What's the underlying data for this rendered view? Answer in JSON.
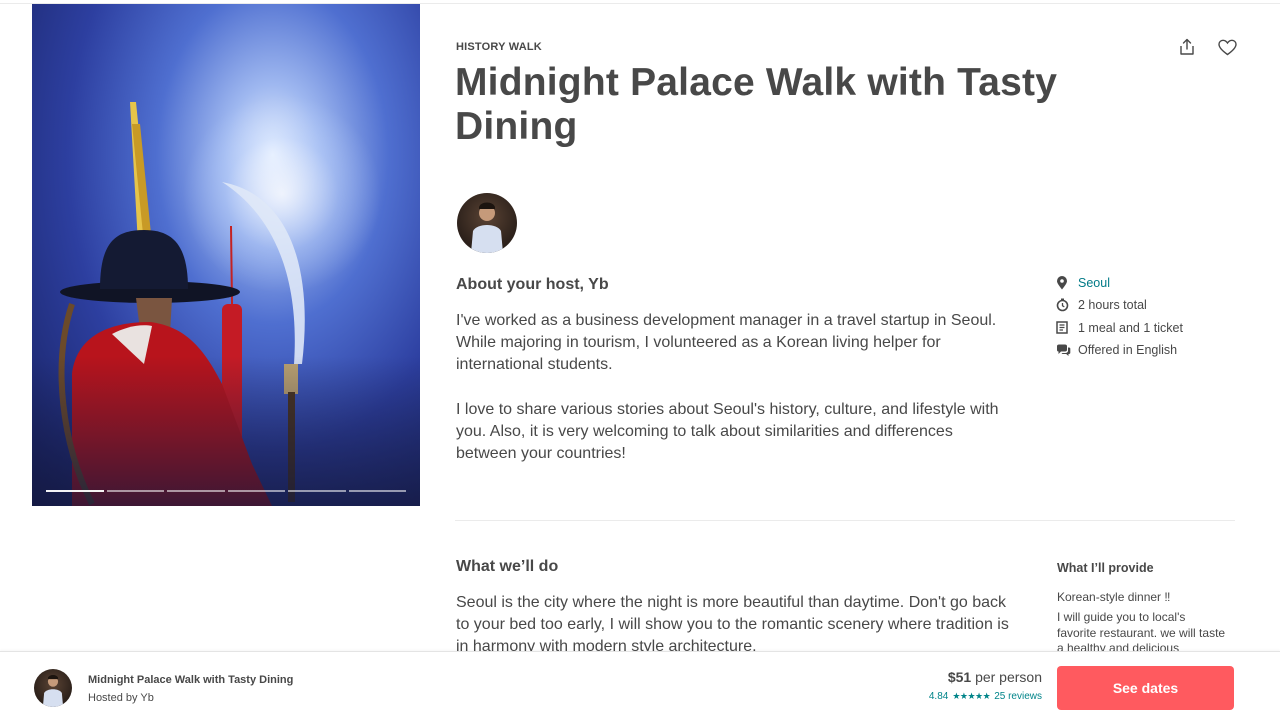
{
  "experience": {
    "category": "HISTORY WALK",
    "title": "Midnight Palace Walk with Tasty Dining"
  },
  "actions": {
    "share_icon": "share-icon",
    "save_icon": "heart-icon"
  },
  "host": {
    "about_title": "About your host, Yb",
    "about_paragraphs": [
      "I've worked as a business development manager in a travel startup in Seoul. While majoring in tourism, I volunteered as a Korean living helper for international students.",
      "I love to share various stories about Seoul's history, culture, and lifestyle with you. Also, it is very welcoming to talk about similarities and differences between your countries!"
    ]
  },
  "facts": [
    {
      "icon": "location-pin-icon",
      "label": "Seoul"
    },
    {
      "icon": "clock-icon",
      "label": "2 hours total"
    },
    {
      "icon": "receipt-icon",
      "label": "1 meal and 1 ticket"
    },
    {
      "icon": "chat-bubbles-icon",
      "label": "Offered in English"
    }
  ],
  "what_we_do": {
    "title": "What we’ll do",
    "text": "Seoul is the city where the night is more beautiful than daytime. Don't go back to your bed too early, I will show you to the romantic scenery where tradition is in harmony with modern style architecture."
  },
  "provide": {
    "title": "What I’ll provide",
    "item": "Korean-style dinner ‼",
    "description": "I will guide you to local's favorite restaurant. we will taste a healthy and delicious"
  },
  "photo": {
    "progress_total": 6,
    "progress_active": 1
  },
  "bottom_bar": {
    "title": "Midnight Palace Walk with Tasty Dining",
    "hosted_by": "Hosted by Yb",
    "price": "$51",
    "price_suffix": "per person",
    "rating": "4.84",
    "stars": "★★★★★",
    "reviews": "25 reviews",
    "cta": "See dates"
  },
  "colors": {
    "text": "#484848",
    "link": "#007a87",
    "rating": "#008489",
    "cta": "#ff5a5f"
  }
}
